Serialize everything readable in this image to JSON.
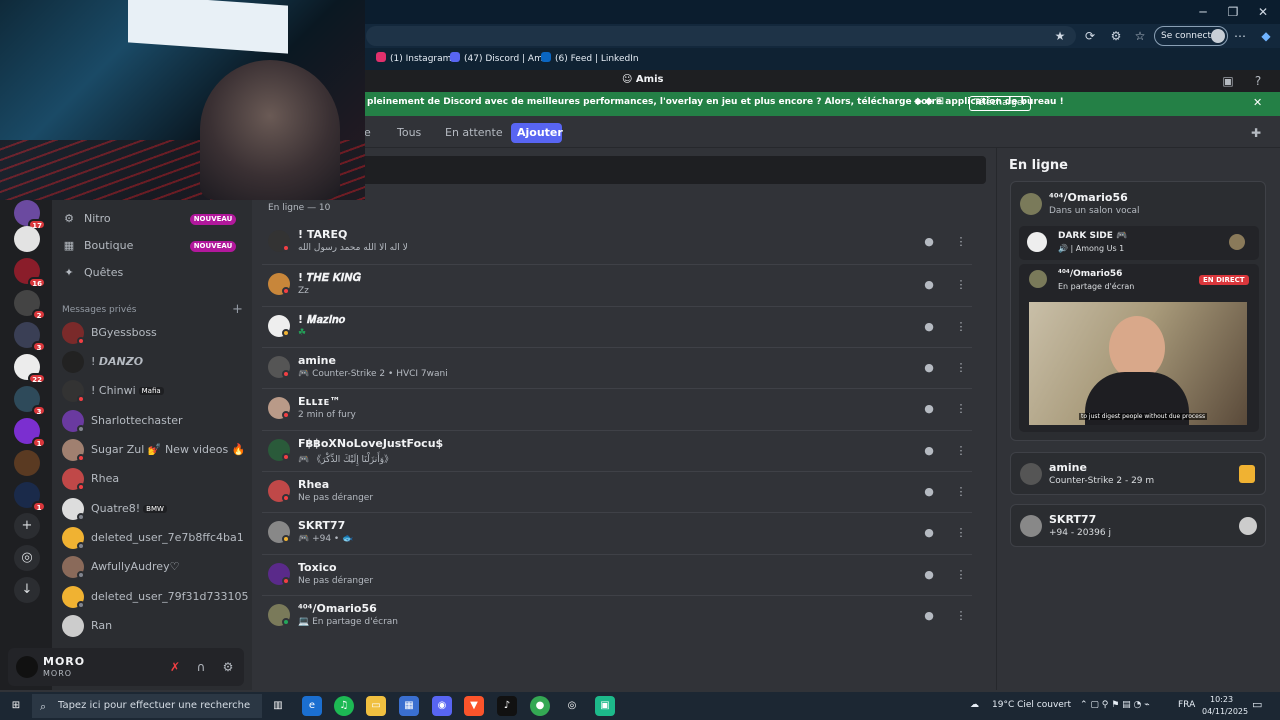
{
  "browser": {
    "signin_label": "Se connecter",
    "bookmarks": [
      {
        "label": "(1) Instagram",
        "color": "#e1306c"
      },
      {
        "label": "(47) Discord | Amis",
        "color": "#5865f2"
      },
      {
        "label": "(6) Feed | LinkedIn",
        "color": "#0a66c2"
      }
    ]
  },
  "header": {
    "title": "Amis"
  },
  "notice": {
    "text": "pleinement de Discord avec de meilleures performances, l'overlay en jeu et plus encore ? Alors, télécharge notre application de bureau !",
    "button": "Télécharger"
  },
  "tabs": {
    "partial": "e",
    "all": "Tous",
    "pending": "En attente",
    "add": "Ajouter"
  },
  "rail": {
    "badges": [
      "17",
      "16",
      "2",
      "3",
      "22",
      "3",
      "1",
      "1"
    ]
  },
  "sidebar": {
    "nitro": "Nitro",
    "shop": "Boutique",
    "quests": "Quêtes",
    "new_badge": "NOUVEAU",
    "dm_header": "Messages privés",
    "dms": [
      {
        "name": "BGyessboss",
        "tag": ""
      },
      {
        "name": "! 𝘿𝘼𝙉𝙕𝙊",
        "tag": ""
      },
      {
        "name": "! Chinwi",
        "tag": "Mafia"
      },
      {
        "name": "Sharlottechaster",
        "tag": ""
      },
      {
        "name": "Sugar Zul 💅 New videos 🔥",
        "tag": ""
      },
      {
        "name": "Rhea",
        "tag": ""
      },
      {
        "name": "Quatre8!",
        "tag": "BMW"
      },
      {
        "name": "deleted_user_7e7b8ffc4ba1",
        "tag": ""
      },
      {
        "name": "AwfullyAudrey♡",
        "tag": ""
      },
      {
        "name": "deleted_user_79f31d733105",
        "tag": ""
      },
      {
        "name": "Ran",
        "tag": ""
      }
    ],
    "user": {
      "name": "MORO",
      "sub": "MORO"
    }
  },
  "main": {
    "online_count": "En ligne — 10",
    "friends": [
      {
        "name": "! TAREQ",
        "sub": "لا اله الا الله محمد رسول الله",
        "status": "#f23f43"
      },
      {
        "name": "! 𝑻𝑯𝑬 𝑲𝑰𝑵𝑮",
        "sub": "Zz",
        "status": "#f23f43"
      },
      {
        "name": "! 𝑴𝒂𝒛𝒊𝒏𝒐",
        "sub": "☘",
        "status": "#f0b232"
      },
      {
        "name": "amine",
        "sub": "🎮 Counter-Strike 2 • HVCI 7wani",
        "status": "#f23f43"
      },
      {
        "name": "Eʟʟɪᴇ™",
        "sub": "2 min of fury",
        "status": "#f23f43"
      },
      {
        "name": "F฿฿oXNoLoveJustFocu$",
        "sub": "🎮 《وَأَنزَلْنَا إِلَيْكَ الذِّكْرَ》",
        "status": "#f23f43"
      },
      {
        "name": "Rhea",
        "sub": "Ne pas déranger",
        "status": "#f23f43"
      },
      {
        "name": "SKRT77",
        "sub": "🎮 +94 • 🐟",
        "status": "#f0b232"
      },
      {
        "name": "Toxico",
        "sub": "Ne pas déranger",
        "status": "#f23f43"
      },
      {
        "name": "⁴⁰⁴/Omario56",
        "sub": "💻 En partage d'écran",
        "status": "#23a55a"
      }
    ]
  },
  "right": {
    "title": "En ligne",
    "voice_card": {
      "user": "⁴⁰⁴/Omario56",
      "where": "Dans un salon vocal",
      "server": "DARK SIDE 🎮",
      "channel": "🔊 | Among Us 1",
      "stream_user": "⁴⁰⁴/Omario56",
      "stream_sub": "En partage d'écran",
      "live": "EN DIRECT",
      "caption": "to just digest people without due process"
    },
    "activity1": {
      "user": "amine",
      "sub": "Counter-Strike 2 - 29 m"
    },
    "activity2": {
      "user": "SKRT77",
      "sub": "+94 - 20396 j"
    }
  },
  "taskbar": {
    "search": "Tapez ici pour effectuer une recherche",
    "weather": "19°C  Ciel couvert",
    "lang": "FRA",
    "time": "10:23",
    "date": "04/11/2025"
  }
}
